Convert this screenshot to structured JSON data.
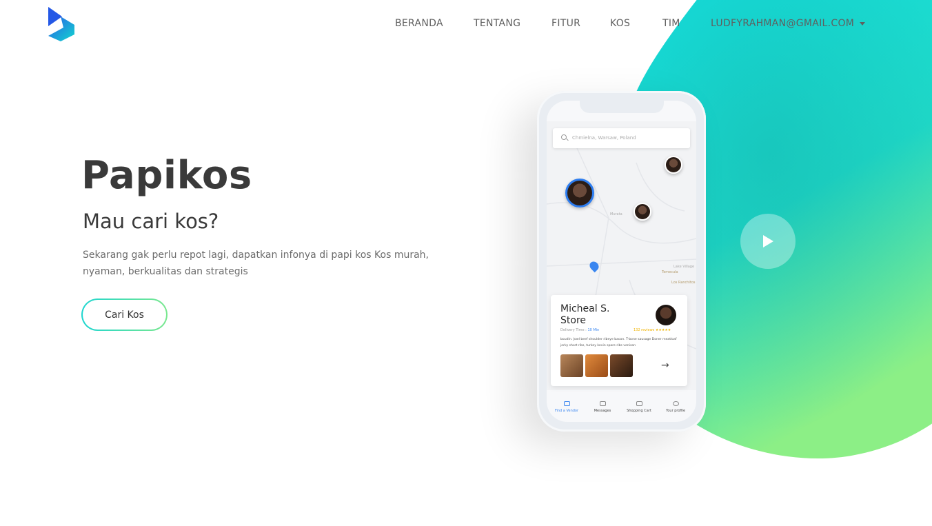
{
  "nav": {
    "items": [
      {
        "label": "BERANDA"
      },
      {
        "label": "TENTANG"
      },
      {
        "label": "FITUR"
      },
      {
        "label": "KOS"
      },
      {
        "label": "TIM"
      }
    ],
    "user_menu": "LUDFYRAHMAN@GMAIL.COM"
  },
  "hero": {
    "title": "Papikos",
    "subtitle": "Mau cari kos?",
    "description": "Sekarang gak perlu repot lagi, dapatkan infonya di papi kos Kos murah, nyaman, berkualitas dan strategis",
    "cta_label": "Cari Kos"
  },
  "phone": {
    "search_placeholder": "Chmielna, Warsaw, Poland",
    "map_labels": {
      "murata": "Murata",
      "lake_village": "Lake Village",
      "temecula": "Temecula",
      "los_ranchitos": "Los Ranchitos"
    },
    "card": {
      "title": "Micheal S. Store",
      "delivery_label": "Delivery Time :",
      "delivery_value": "10 Min",
      "reviews": "132 reviews",
      "stars": "★★★★★",
      "text": "boudin. Jowl beef shoulder ribeye bacon. T-bone sausage Doner meatloaf jerky short ribs, turkey kevin spare ribs venison",
      "arrow": "→"
    },
    "tabs": [
      {
        "label": "Find a Vendor"
      },
      {
        "label": "Messages"
      },
      {
        "label": "Shopping Cart"
      },
      {
        "label": "Your profile"
      }
    ]
  },
  "colors": {
    "accent_start": "#1fd6d0",
    "accent_end": "#7be88f",
    "text_dark": "#3a3a3a"
  },
  "icons": {
    "logo": "play-chevron-logo",
    "play": "play-icon",
    "caret": "caret-down-icon"
  }
}
